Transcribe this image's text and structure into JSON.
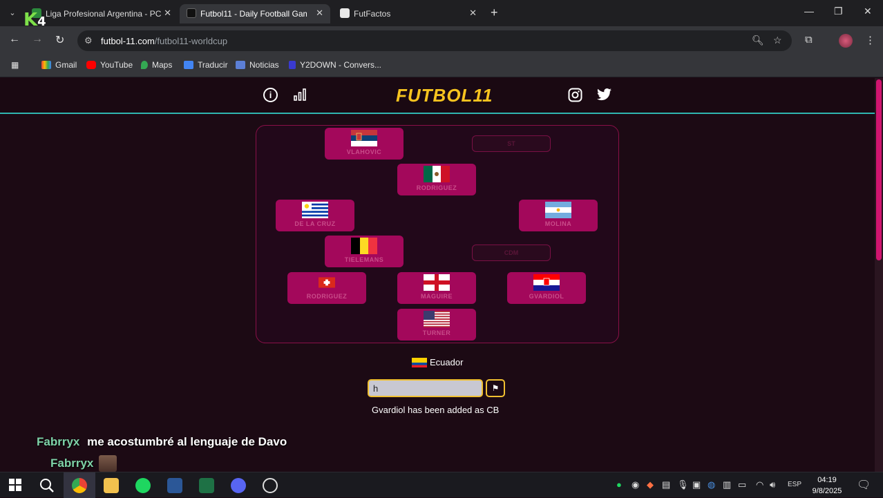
{
  "browser": {
    "tabs": [
      {
        "title": "Liga Profesional Argentina - PC",
        "active": false
      },
      {
        "title": "Futbol11 - Daily Football Game",
        "active": true
      },
      {
        "title": "FutFactos",
        "active": false
      }
    ],
    "url_host": "futbol-11.com",
    "url_path": "/futbol11-worldcup",
    "bookmarks": [
      "Gmail",
      "YouTube",
      "Maps",
      "Traducir",
      "Noticias",
      "Y2DOWN - Convers..."
    ]
  },
  "overlay": {
    "brand_letter": "K",
    "brand_number": "4"
  },
  "site": {
    "logo": "FUTBOL11",
    "players": [
      {
        "name": "VLAHOVIC",
        "country": "Serbia"
      },
      {
        "name": "RODRIGUEZ",
        "country": "Mexico"
      },
      {
        "name": "DE LA CRUZ",
        "country": "Uruguay"
      },
      {
        "name": "MOLINA",
        "country": "Argentina"
      },
      {
        "name": "TIELEMANS",
        "country": "Belgium"
      },
      {
        "name": "RODRIGUEZ",
        "country": "Switzerland"
      },
      {
        "name": "MAGUIRE",
        "country": "England"
      },
      {
        "name": "GVARDIOL",
        "country": "Croatia"
      },
      {
        "name": "TURNER",
        "country": "USA"
      }
    ],
    "empty_slots": [
      "ST",
      "CDM"
    ],
    "current_country": "Ecuador",
    "guess_value": "h",
    "status_message": "Gvardiol has been added as CB"
  },
  "chat": [
    {
      "user": "Fabrryx",
      "message": "me acostumbré al lenguaje de Davo"
    },
    {
      "user": "Fabrryx",
      "message": ""
    }
  ],
  "taskbar": {
    "language": "ESP",
    "time": "04:19",
    "date": "9/8/2025"
  }
}
